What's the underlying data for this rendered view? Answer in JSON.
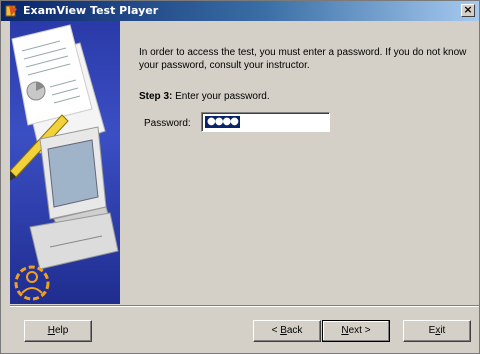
{
  "window": {
    "title": "ExamView Test Player",
    "close_glyph": "×"
  },
  "content": {
    "intro": "In order to access the test, you must enter a password.  If you do not know your password, consult your instructor.",
    "step_label": "Step 3:",
    "step_text": "Enter your password.",
    "password_label": "Password:",
    "password_mask": "●●●●"
  },
  "buttons": {
    "help": {
      "pre": "",
      "u": "H",
      "post": "elp"
    },
    "back": {
      "pre": "< ",
      "u": "B",
      "post": "ack"
    },
    "next": {
      "pre": "",
      "u": "N",
      "post": "ext >"
    },
    "exit": {
      "pre": "E",
      "u": "x",
      "post": "it"
    }
  },
  "colors": {
    "titlebar": "#0a246a",
    "sidebar": "#2a3aa8",
    "face": "#d4d0c8",
    "selection": "#0a246a"
  },
  "icons": {
    "app": "examview-app-icon",
    "sidebar_art": "test-papers-computer-illustration"
  }
}
